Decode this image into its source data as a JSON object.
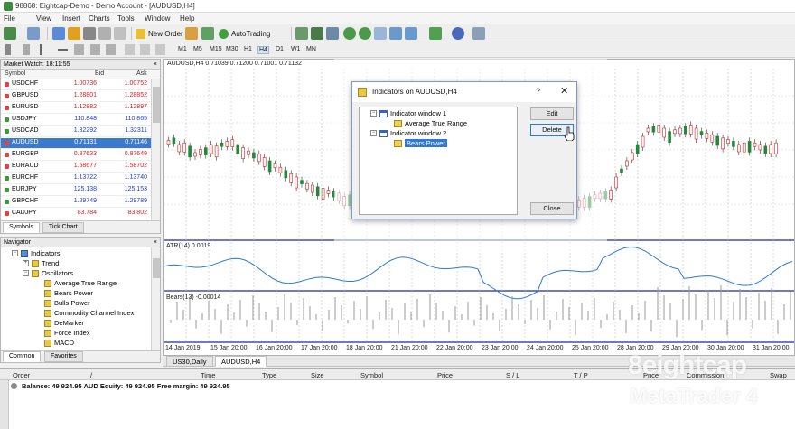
{
  "window": {
    "title": "98868: Eightcap-Demo - Demo Account - [AUDUSD,H4]"
  },
  "menu": [
    "File",
    "View",
    "Insert",
    "Charts",
    "Tools",
    "Window",
    "Help"
  ],
  "toolbar": {
    "new_order": "New Order",
    "autotrading": "AutoTrading"
  },
  "timeframes": [
    "M1",
    "M5",
    "M15",
    "M30",
    "H1",
    "H4",
    "D1",
    "W1",
    "MN"
  ],
  "active_timeframe": "H4",
  "market_watch": {
    "title": "Market Watch: 18:11:55",
    "columns": {
      "symbol": "Symbol",
      "bid": "Bid",
      "ask": "Ask"
    },
    "rows": [
      {
        "symbol": "USDCHF",
        "bid": "1.00736",
        "ask": "1.00752",
        "color": "red",
        "dir": "down"
      },
      {
        "symbol": "GBPUSD",
        "bid": "1.28801",
        "ask": "1.28852",
        "color": "red",
        "dir": "down"
      },
      {
        "symbol": "EURUSD",
        "bid": "1.12882",
        "ask": "1.12897",
        "color": "red",
        "dir": "down"
      },
      {
        "symbol": "USDJPY",
        "bid": "110.848",
        "ask": "110.865",
        "color": "blue",
        "dir": "up"
      },
      {
        "symbol": "USDCAD",
        "bid": "1.32292",
        "ask": "1.32311",
        "color": "blue",
        "dir": "up"
      },
      {
        "symbol": "AUDUSD",
        "bid": "0.71131",
        "ask": "0.71146",
        "color": "sel",
        "dir": "down"
      },
      {
        "symbol": "EURGBP",
        "bid": "0.87633",
        "ask": "0.87649",
        "color": "red",
        "dir": "down"
      },
      {
        "symbol": "EURAUD",
        "bid": "1.58677",
        "ask": "1.58702",
        "color": "red",
        "dir": "down"
      },
      {
        "symbol": "EURCHF",
        "bid": "1.13722",
        "ask": "1.13740",
        "color": "blue",
        "dir": "up"
      },
      {
        "symbol": "EURJPY",
        "bid": "125.138",
        "ask": "125.153",
        "color": "blue",
        "dir": "up"
      },
      {
        "symbol": "GBPCHF",
        "bid": "1.29749",
        "ask": "1.29789",
        "color": "blue",
        "dir": "up"
      },
      {
        "symbol": "CADJPY",
        "bid": "83.784",
        "ask": "83.802",
        "color": "red",
        "dir": "down"
      }
    ],
    "tabs": [
      "Symbols",
      "Tick Chart"
    ]
  },
  "navigator": {
    "title": "Navigator",
    "items": [
      "Indicators",
      "Trend",
      "Oscillators",
      "Average True Range",
      "Bears Power",
      "Bulls Power",
      "Commodity Channel Index",
      "DeMarker",
      "Force Index",
      "MACD"
    ],
    "tabs": [
      "Common",
      "Favorites"
    ]
  },
  "chart": {
    "header": "AUDUSD,H4  0.71039 0.71200 0.71001 0.71132",
    "atr_label": "ATR(14) 0.0019",
    "bears_label": "Bears(13) -0.00014",
    "dates": [
      "14 Jan 2019",
      "15 Jan 20:00",
      "16 Jan 20:00",
      "17 Jan 20:00",
      "18 Jan 20:00",
      "21 Jan 20:00",
      "22 Jan 20:00",
      "23 Jan 20:00",
      "24 Jan 20:00",
      "25 Jan 20:00",
      "28 Jan 20:00",
      "29 Jan 20:00",
      "30 Jan 20:00",
      "31 Jan 20:00"
    ],
    "tabs": [
      "US30,Daily",
      "AUDUSD,H4"
    ]
  },
  "dialog": {
    "title": "Indicators on AUDUSD,H4",
    "help": "?",
    "close": "✕",
    "tree": [
      "Indicator window 1",
      "Average True Range",
      "Indicator window 2",
      "Bears Power"
    ],
    "buttons": {
      "edit": "Edit",
      "delete": "Delete",
      "close": "Close"
    }
  },
  "terminal": {
    "columns": [
      "Order",
      "/",
      "Time",
      "Type",
      "Size",
      "Symbol",
      "Price",
      "S / L",
      "T / P",
      "Price",
      "Commission",
      "Swap"
    ],
    "balance": "Balance: 49 924.95 AUD  Equity: 49 924.95  Free margin: 49 924.95"
  },
  "watermark": {
    "brand": "eightcap",
    "product": "MetaTrader 4",
    "brand_mark": "8"
  }
}
